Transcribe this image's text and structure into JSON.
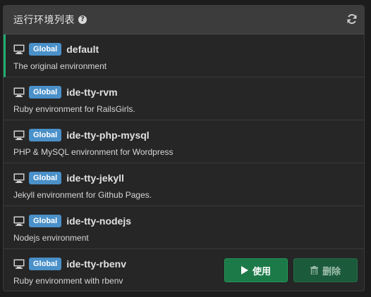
{
  "panel": {
    "title": "运行环境列表",
    "help_icon": "question-circle-icon",
    "refresh_icon": "refresh-icon"
  },
  "environments": [
    {
      "scope": "Global",
      "name": "default",
      "description": "The original environment",
      "active": true
    },
    {
      "scope": "Global",
      "name": "ide-tty-rvm",
      "description": "Ruby environment for RailsGirls."
    },
    {
      "scope": "Global",
      "name": "ide-tty-php-mysql",
      "description": "PHP & MySQL environment for Wordpress"
    },
    {
      "scope": "Global",
      "name": "ide-tty-jekyll",
      "description": "Jekyll environment for Github Pages."
    },
    {
      "scope": "Global",
      "name": "ide-tty-nodejs",
      "description": "Nodejs environment"
    },
    {
      "scope": "Global",
      "name": "ide-tty-rbenv",
      "description": "Ruby environment with rbenv"
    }
  ],
  "actions": {
    "use_label": "使用",
    "use_icon": "play-icon",
    "delete_label": "删除",
    "delete_icon": "trash-icon"
  },
  "colors": {
    "active_indicator": "#1fae72",
    "badge": "#4a90c9",
    "use_button": "#1c7a48",
    "delete_button": "#1b5a3a"
  }
}
